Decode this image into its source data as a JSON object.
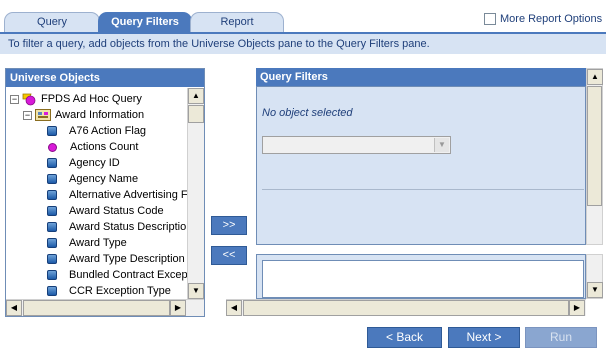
{
  "tabs": {
    "query": "Query",
    "query_filters": "Query Filters",
    "report": "Report"
  },
  "more_options_label": "More Report Options",
  "info_text": "To filter a query, add objects from the Universe Objects pane to the Query Filters pane.",
  "universe": {
    "title": "Universe Objects",
    "root": "FPDS Ad Hoc Query",
    "class": "Award Information",
    "items": [
      {
        "label": "A76 Action Flag",
        "kind": "dimension"
      },
      {
        "label": "Actions Count",
        "kind": "measure"
      },
      {
        "label": "Agency ID",
        "kind": "dimension"
      },
      {
        "label": "Agency Name",
        "kind": "dimension"
      },
      {
        "label": "Alternative Advertising F",
        "kind": "dimension"
      },
      {
        "label": "Award Status Code",
        "kind": "dimension"
      },
      {
        "label": "Award Status Descriptio",
        "kind": "dimension"
      },
      {
        "label": "Award Type",
        "kind": "dimension"
      },
      {
        "label": "Award Type Description",
        "kind": "dimension"
      },
      {
        "label": "Bundled Contract Excep",
        "kind": "dimension"
      },
      {
        "label": "CCR Exception Type",
        "kind": "dimension"
      }
    ]
  },
  "arrows": {
    "add": ">>",
    "remove": "<<"
  },
  "query_filters": {
    "title": "Query Filters",
    "no_object": "No object selected",
    "select_value": ""
  },
  "nav": {
    "back": "< Back",
    "next": "Next >",
    "run": "Run"
  },
  "colors": {
    "accent": "#4b79bd",
    "pane_bg": "#d7e3f3",
    "text_blue": "#1f3f7a"
  }
}
